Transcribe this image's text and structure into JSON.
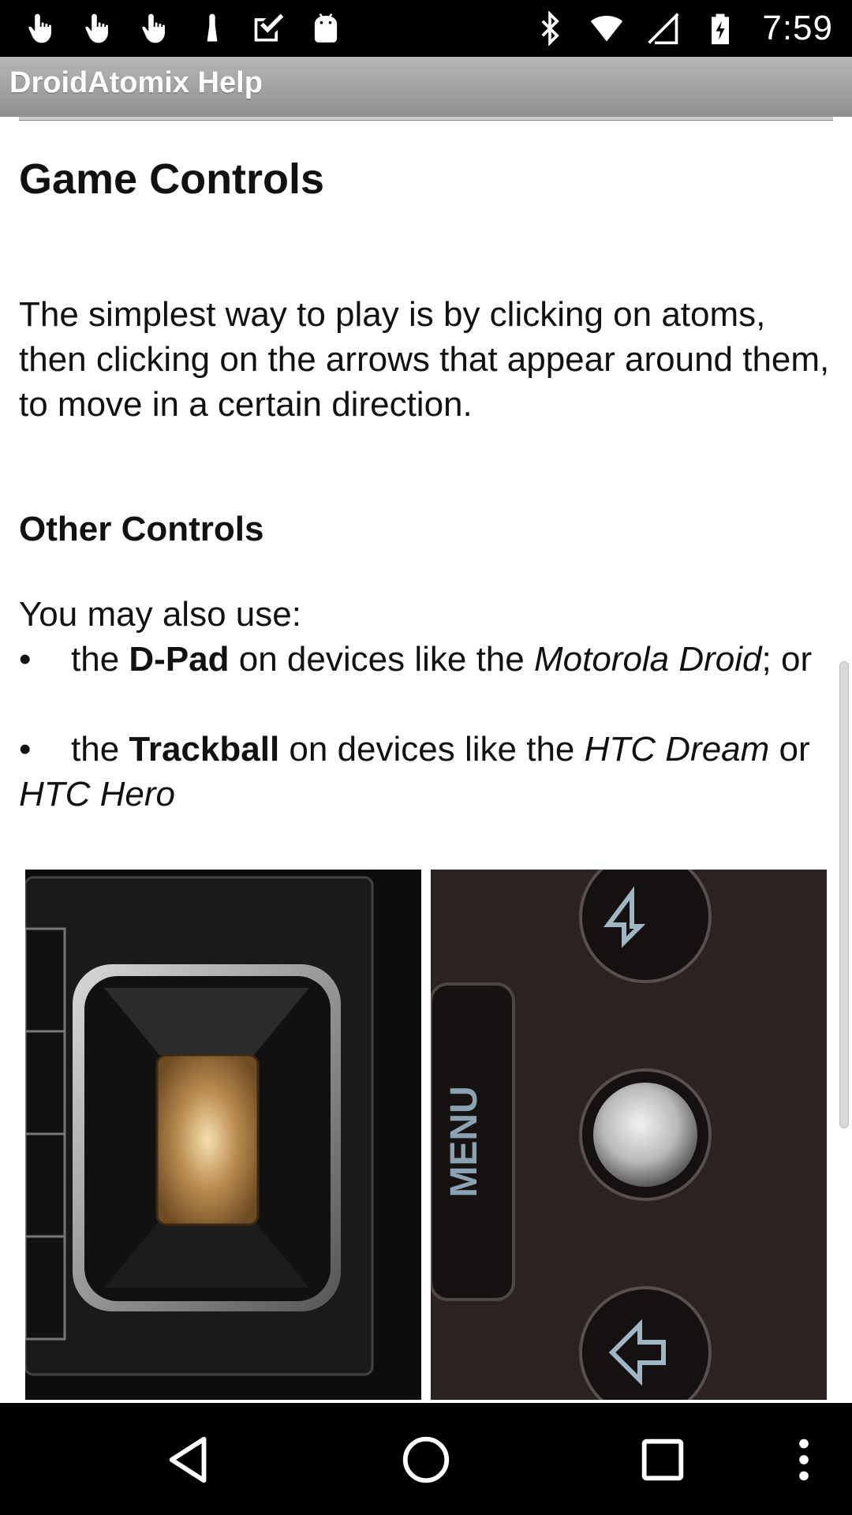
{
  "status_bar": {
    "time": "7:59",
    "left_icons": [
      "touch-icon",
      "touch-icon",
      "touch-icon",
      "touch-icon",
      "check-icon",
      "android-icon"
    ],
    "right_icons": [
      "bluetooth-icon",
      "wifi-icon",
      "no-sim-icon",
      "battery-icon"
    ]
  },
  "app": {
    "title": "DroidAtomix Help"
  },
  "content": {
    "heading": "Game Controls",
    "intro": "The simplest way to play is by clicking on atoms, then clicking on the arrows that appear around them, to move in a certain direction.",
    "subheading": "Other Controls",
    "may_also": "You may also use:",
    "bullets": [
      {
        "bullet": "•",
        "pre": "the ",
        "bold": "D-Pad",
        "mid": " on devices like the ",
        "italic": "Motorola Droid",
        "post": "; or",
        "italic2": "",
        "end": ""
      },
      {
        "bullet": "•",
        "pre": "the ",
        "bold": "Trackball",
        "mid": " on devices like the ",
        "italic": "HTC Dream",
        "post": " or ",
        "italic2": "HTC Hero",
        "end": ""
      }
    ],
    "images": [
      {
        "icon": "dpad-photo"
      },
      {
        "icon": "trackball-photo",
        "menu_label": "MENU"
      }
    ]
  },
  "navbar": {
    "buttons": [
      "back-icon",
      "home-icon",
      "recents-icon",
      "overflow-menu-icon"
    ]
  }
}
